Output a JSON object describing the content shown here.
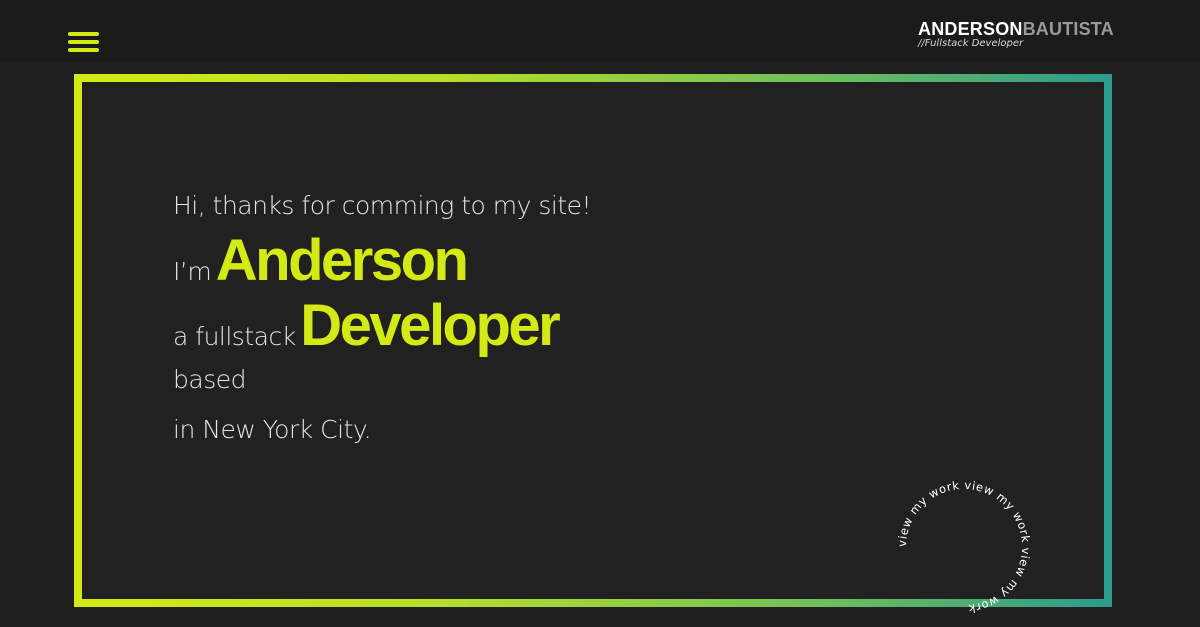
{
  "header": {
    "menu_icon": "hamburger-icon",
    "logo_first": "ANDERSON",
    "logo_last": "BAUTISTA",
    "logo_tagline": "//Fullstack Developer"
  },
  "hero": {
    "greeting": "Hi, thanks for comming to my site!",
    "im_prefix": "I’m",
    "name": "Anderson",
    "role_prefix": "a fullstack",
    "role": "Developer",
    "based": "based",
    "location": "in New York City."
  },
  "cta": {
    "circular_text": "view my work view my work view my work "
  },
  "colors": {
    "accent": "#d4ea14",
    "gradient_end": "#2d9a8c",
    "background": "#212122"
  }
}
